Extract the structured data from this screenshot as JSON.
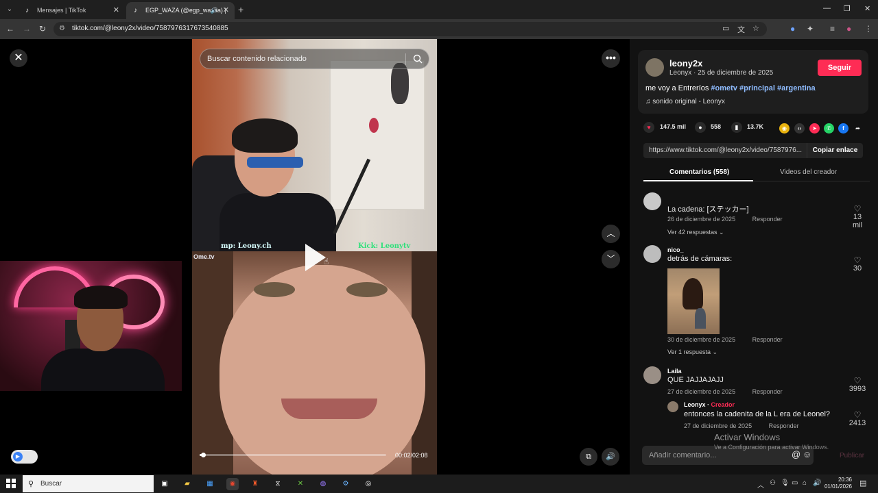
{
  "browser": {
    "tabs": [
      {
        "title": "Mensajes | TikTok"
      },
      {
        "title": "EGP_WAZA (@egp_wazaa) |"
      }
    ],
    "url": "tiktok.com/@leony2x/video/7587976317673540885"
  },
  "video": {
    "search_placeholder": "Buscar contenido relacionado",
    "overlay_left": "mp: Leony.ch",
    "overlay_right": "Kick: Leonytv",
    "ome_logo": "Ome.tv",
    "progress": 0.02,
    "time": "00:02/02:08"
  },
  "post": {
    "username": "leony2x",
    "meta": "Leonyx · 25 de diciembre de 2025",
    "follow_label": "Seguir",
    "caption_text": "me voy a Entreríos",
    "hashtags": [
      "#ometv",
      "#principal",
      "#argentina"
    ],
    "music": "sonido original - Leonyx",
    "likes": "147.5 mil",
    "comments_count": "558",
    "saves": "13.7K",
    "link": "https://www.tiktok.com/@leony2x/video/7587976...",
    "copy_label": "Copiar enlace",
    "tab_comments": "Comentarios (558)",
    "tab_creator": "Videos del creador"
  },
  "comments": [
    {
      "text": "La cadena: [ステッカー]",
      "date": "26 de diciembre de 2025",
      "reply": "Responder",
      "likes": "13\nmil",
      "likes_a": "13",
      "likes_b": "mil",
      "more": "Ver 42 respuestas"
    },
    {
      "user": "nico_",
      "text": "detrás de cámaras:",
      "date": "30 de diciembre de 2025",
      "reply": "Responder",
      "likes": "30",
      "more": "Ver 1 respuesta"
    },
    {
      "user": "Laila",
      "text": "QUE JAJJAJAJJ",
      "date": "27 de diciembre de 2025",
      "reply": "Responder",
      "likes": "3993"
    },
    {
      "user": "Leonyx",
      "badge": "Creador",
      "text": "entonces la cadenita de la L era de Leonel?",
      "date": "27 de diciembre de 2025",
      "reply": "Responder",
      "likes": "2413"
    }
  ],
  "composer": {
    "placeholder": "Añadir comentario...",
    "publish": "Publicar"
  },
  "watermark": {
    "line1": "Activar Windows",
    "line2": "Ve a Configuración para activar Windows."
  },
  "taskbar": {
    "search": "Buscar",
    "time": "20:36",
    "date": "01/01/2026"
  }
}
